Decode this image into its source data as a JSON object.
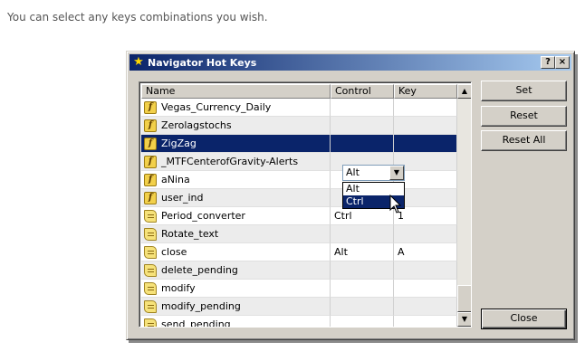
{
  "page": {
    "intro_text": "You can select any keys combinations you wish."
  },
  "dialog": {
    "title": "Navigator Hot Keys",
    "help_label": "?",
    "close_label": "×"
  },
  "table": {
    "columns": [
      "Name",
      "Control",
      "Key"
    ],
    "rows": [
      {
        "name": "Vegas_Currency_Daily",
        "control": "",
        "key": "",
        "icon": "function-icon"
      },
      {
        "name": "Zerolagstochs",
        "control": "",
        "key": "",
        "icon": "function-icon"
      },
      {
        "name": "ZigZag",
        "control": "Alt",
        "key": "",
        "icon": "function-icon"
      },
      {
        "name": "_MTFCenterofGravity-Alerts",
        "control": "",
        "key": "",
        "icon": "function-icon"
      },
      {
        "name": "aNina",
        "control": "",
        "key": "",
        "icon": "function-icon"
      },
      {
        "name": "user_ind",
        "control": "",
        "key": "",
        "icon": "function-icon"
      },
      {
        "name": "Period_converter",
        "control": "Ctrl",
        "key": "1",
        "icon": "script-icon"
      },
      {
        "name": "Rotate_text",
        "control": "",
        "key": "",
        "icon": "script-icon"
      },
      {
        "name": "close",
        "control": "Alt",
        "key": "A",
        "icon": "script-icon"
      },
      {
        "name": "delete_pending",
        "control": "",
        "key": "",
        "icon": "script-icon"
      },
      {
        "name": "modify",
        "control": "",
        "key": "",
        "icon": "script-icon"
      },
      {
        "name": "modify_pending",
        "control": "",
        "key": "",
        "icon": "script-icon"
      },
      {
        "name": "send_pending",
        "control": "",
        "key": "",
        "icon": "script-icon"
      }
    ]
  },
  "combo": {
    "value": "Alt",
    "options": [
      "Alt",
      "Ctrl"
    ],
    "highlighted": "Ctrl"
  },
  "buttons": {
    "set": "Set",
    "reset": "Reset",
    "reset_all": "Reset All",
    "close": "Close"
  },
  "colors": {
    "selection": "#0a246a",
    "title_gradient_start": "#0a246a",
    "title_gradient_end": "#a6caf0",
    "face": "#d4d0c8"
  }
}
